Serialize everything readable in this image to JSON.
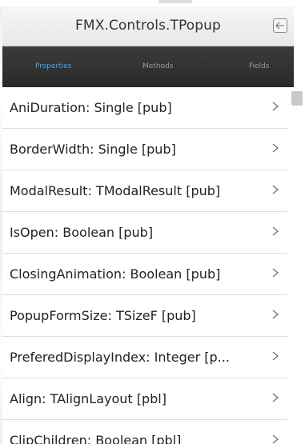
{
  "window": {
    "title": "FMX.Controls.TPopup"
  },
  "icons": {
    "back": "arrow-left-icon",
    "chevron": "chevron-right-icon"
  },
  "tabs": [
    {
      "label": "Properties",
      "active": true
    },
    {
      "label": "Methods",
      "active": false
    },
    {
      "label": "Fields",
      "active": false
    }
  ],
  "colors": {
    "active_tab": "#4aa8e6",
    "tabbar_bg": "#2f2f2f",
    "title_bg": "#ececec"
  },
  "list": {
    "items": [
      {
        "label": "AniDuration: Single [pub]"
      },
      {
        "label": "BorderWidth: Single [pub]"
      },
      {
        "label": "ModalResult: TModalResult [pub]"
      },
      {
        "label": "IsOpen: Boolean [pub]"
      },
      {
        "label": "ClosingAnimation: Boolean [pub]"
      },
      {
        "label": "PopupFormSize: TSizeF [pub]"
      },
      {
        "label": "PreferedDisplayIndex: Integer [p..."
      },
      {
        "label": "Align: TAlignLayout [pbl]"
      },
      {
        "label": "ClipChildren: Boolean [pbl]"
      }
    ]
  }
}
